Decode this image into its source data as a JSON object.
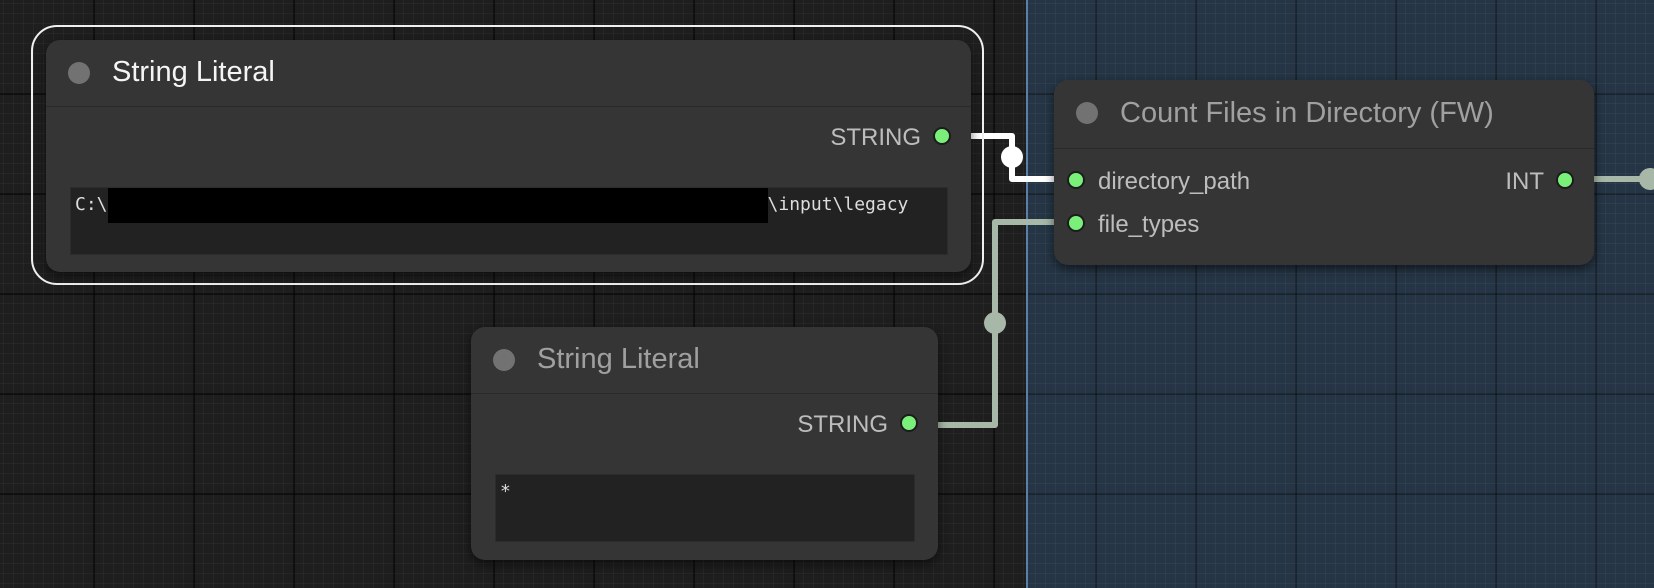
{
  "nodes": {
    "string_literal_1": {
      "title": "String Literal",
      "output_label": "STRING",
      "value_prefix": "C:\\",
      "value_suffix": "\\input\\legacy"
    },
    "string_literal_2": {
      "title": "String Literal",
      "output_label": "STRING",
      "value": "*"
    },
    "count_files": {
      "title": "Count Files in Directory (FW)",
      "inputs": [
        "directory_path",
        "file_types"
      ],
      "output_label": "INT"
    }
  },
  "colors": {
    "canvas": "#1e1e1e",
    "group": "#253545",
    "node": "#353535",
    "slot_string": "#7af07a",
    "link_selected": "#ffffff",
    "link": "#a8b8a8"
  }
}
